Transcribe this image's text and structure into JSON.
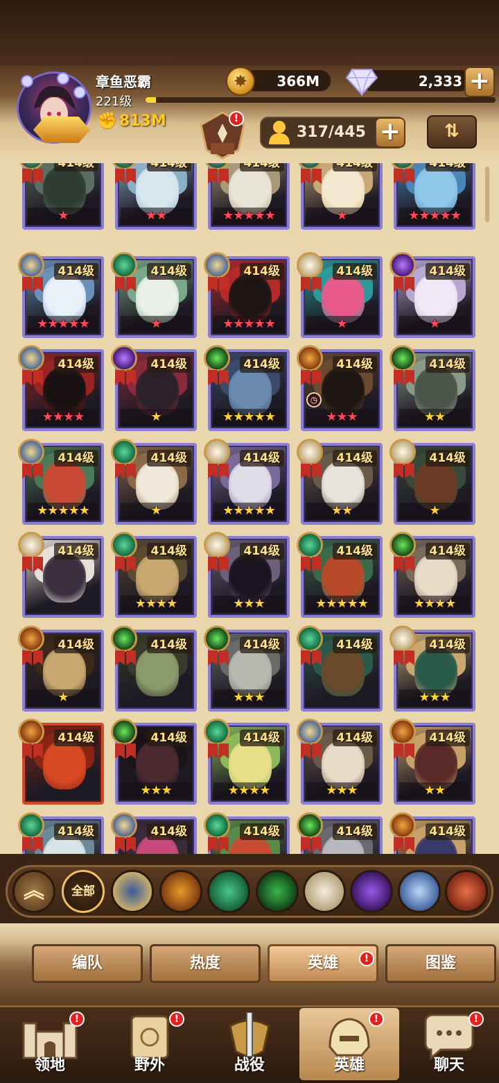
{
  "player": {
    "name": "章鱼恶霸",
    "level": "221级",
    "xp_progress": 0.03,
    "power": "813M"
  },
  "currencies": {
    "gold": "366M",
    "diamonds": "2,333"
  },
  "roster": {
    "count": "317/445"
  },
  "hero_level_label": "414级",
  "heroes": [
    {
      "level": "414级",
      "faction": "forest",
      "stars": "★",
      "star_color": "red",
      "palette": [
        "#2f3c34",
        "#5a6e64"
      ]
    },
    {
      "level": "414级",
      "faction": "forest",
      "stars": "★★",
      "star_color": "red",
      "palette": [
        "#d8e6ee",
        "#8ab0c8"
      ]
    },
    {
      "level": "414级",
      "faction": "forest",
      "stars": "★★★★★",
      "star_color": "red",
      "palette": [
        "#e8e4d8",
        "#a89a78"
      ]
    },
    {
      "level": "414级",
      "faction": "forest",
      "stars": "★",
      "star_color": "red",
      "palette": [
        "#f4e8d0",
        "#c8a878"
      ]
    },
    {
      "level": "414级",
      "faction": "forest",
      "stars": "★★★★★",
      "star_color": "red",
      "palette": [
        "#8fc8e8",
        "#4a86b8"
      ]
    },
    {
      "level": "414级",
      "faction": "lightbearer",
      "stars": "★★★★★",
      "star_color": "red",
      "palette": [
        "#e8f0f8",
        "#6a90b8"
      ]
    },
    {
      "level": "414级",
      "faction": "wilder",
      "stars": "★",
      "star_color": "red",
      "palette": [
        "#e8f0e8",
        "#7aa88a"
      ]
    },
    {
      "level": "414级",
      "faction": "lightbearer",
      "stars": "★★★★★",
      "star_color": "red",
      "palette": [
        "#1e1414",
        "#b42a2a"
      ]
    },
    {
      "level": "414级",
      "faction": "celestial",
      "stars": "★",
      "star_color": "red",
      "palette": [
        "#e85a8a",
        "#2a9a9a"
      ]
    },
    {
      "level": "414级",
      "faction": "hypogean",
      "stars": "★",
      "star_color": "red",
      "palette": [
        "#f0e8f4",
        "#b8a8d0"
      ]
    },
    {
      "level": "414级",
      "faction": "lightbearer",
      "stars": "★★★★",
      "star_color": "red",
      "palette": [
        "#1a1212",
        "#9a2424"
      ]
    },
    {
      "level": "414级",
      "faction": "hypogean",
      "stars": "★",
      "star_color": "gold",
      "palette": [
        "#2a2228",
        "#8a2a3a"
      ]
    },
    {
      "level": "414级",
      "faction": "graveborn",
      "stars": "★★★★★",
      "star_color": "gold",
      "palette": [
        "#6a8ab0",
        "#3a4a68"
      ]
    },
    {
      "level": "414级",
      "faction": "mauler",
      "stars": "★★★",
      "star_color": "red",
      "palette": [
        "#1e1612",
        "#6a4a30"
      ],
      "clock": true
    },
    {
      "level": "414级",
      "faction": "graveborn",
      "stars": "★★",
      "star_color": "gold",
      "palette": [
        "#4a5448",
        "#8a9a88"
      ]
    },
    {
      "level": "414级",
      "faction": "lightbearer",
      "stars": "★★★★★",
      "star_color": "gold",
      "palette": [
        "#c84a34",
        "#4a7a5a"
      ]
    },
    {
      "level": "414级",
      "faction": "wilder",
      "stars": "★",
      "star_color": "gold",
      "palette": [
        "#f0e8d8",
        "#8a6a48"
      ]
    },
    {
      "level": "414级",
      "faction": "celestial",
      "stars": "★★★★★",
      "star_color": "gold",
      "palette": [
        "#e0dce8",
        "#7a6a9a"
      ]
    },
    {
      "level": "414级",
      "faction": "celestial",
      "stars": "★★",
      "star_color": "gold",
      "palette": [
        "#e8e4dc",
        "#6a5a48"
      ]
    },
    {
      "level": "414级",
      "faction": "celestial",
      "stars": "★",
      "star_color": "gold",
      "palette": [
        "#6a3a24",
        "#3a4a3a"
      ]
    },
    {
      "level": "414级",
      "faction": "celestial",
      "stars": "",
      "star_color": "gold",
      "palette": [
        "#3a3040",
        "#e8e0d8"
      ]
    },
    {
      "level": "414级",
      "faction": "wilder",
      "stars": "★★★★",
      "star_color": "gold",
      "palette": [
        "#c8a870",
        "#5a4a30"
      ]
    },
    {
      "level": "414级",
      "faction": "celestial",
      "stars": "★★★",
      "star_color": "gold",
      "palette": [
        "#1a1420",
        "#6a6078"
      ]
    },
    {
      "level": "414级",
      "faction": "wilder",
      "stars": "★★★★★",
      "star_color": "gold",
      "palette": [
        "#b84a2a",
        "#3a6a4a"
      ]
    },
    {
      "level": "414级",
      "faction": "graveborn",
      "stars": "★★★★",
      "star_color": "gold",
      "palette": [
        "#e8dcc8",
        "#7a6a5a"
      ]
    },
    {
      "level": "414级",
      "faction": "mauler",
      "stars": "★",
      "star_color": "gold",
      "palette": [
        "#c8a870",
        "#3a2818"
      ]
    },
    {
      "level": "414级",
      "faction": "graveborn",
      "stars": "",
      "star_color": "gold",
      "palette": [
        "#8a9a6a",
        "#3a3a2a"
      ]
    },
    {
      "level": "414级",
      "faction": "graveborn",
      "stars": "★★★",
      "star_color": "gold",
      "palette": [
        "#b8b8b0",
        "#6a6a68"
      ]
    },
    {
      "level": "414级",
      "faction": "wilder",
      "stars": "",
      "star_color": "gold",
      "palette": [
        "#6a4a2a",
        "#2a5a4a"
      ]
    },
    {
      "level": "414级",
      "faction": "celestial",
      "stars": "★★★",
      "star_color": "gold",
      "palette": [
        "#2a5a4a",
        "#c8a870"
      ]
    },
    {
      "level": "414级",
      "faction": "mauler",
      "stars": "",
      "star_color": "gold",
      "palette": [
        "#d84a24",
        "#8a2414"
      ],
      "red_frame": true
    },
    {
      "level": "414级",
      "faction": "graveborn",
      "stars": "★★★",
      "star_color": "gold",
      "palette": [
        "#4a2a30",
        "#1a1418"
      ]
    },
    {
      "level": "414级",
      "faction": "wilder",
      "stars": "★★★★",
      "star_color": "gold",
      "palette": [
        "#e8e088",
        "#8ab85a"
      ]
    },
    {
      "level": "414级",
      "faction": "lightbearer",
      "stars": "★★★",
      "star_color": "gold",
      "palette": [
        "#e8dcc8",
        "#6a5a48"
      ]
    },
    {
      "level": "414级",
      "faction": "mauler",
      "stars": "★★",
      "star_color": "gold",
      "palette": [
        "#5a2a28",
        "#c8a06a"
      ]
    },
    {
      "level": "414级",
      "faction": "wilder",
      "stars": "",
      "star_color": "gold",
      "palette": [
        "#d8e4e8",
        "#6a8a98"
      ]
    },
    {
      "level": "414级",
      "faction": "lightbearer",
      "stars": "",
      "star_color": "gold",
      "palette": [
        "#c84a7a",
        "#3a2a3a"
      ]
    },
    {
      "level": "414级",
      "faction": "wilder",
      "stars": "",
      "star_color": "gold",
      "palette": [
        "#c84a34",
        "#5a8a4a"
      ]
    },
    {
      "level": "414级",
      "faction": "graveborn",
      "stars": "",
      "star_color": "gold",
      "palette": [
        "#b8b8c0",
        "#6a6870"
      ]
    },
    {
      "level": "414级",
      "faction": "mauler",
      "stars": "",
      "star_color": "gold",
      "palette": [
        "#3a3a6a",
        "#c8a06a"
      ]
    }
  ],
  "faction_filters": [
    {
      "id": "collapse",
      "label": "",
      "icon": "chevron-up-icon",
      "colors": [
        "#a07a48",
        "#5a3a1c"
      ]
    },
    {
      "id": "all",
      "label": "全部",
      "icon": "",
      "colors": [
        "#4a3018",
        "#2a1a0c"
      ]
    },
    {
      "id": "lightbearer",
      "label": "",
      "icon": "lightbearer-icon",
      "colors": [
        "#3a5a9a",
        "#e8c060"
      ]
    },
    {
      "id": "mauler",
      "label": "",
      "icon": "mauler-icon",
      "colors": [
        "#e89a2a",
        "#6a2a0a"
      ]
    },
    {
      "id": "wilder",
      "label": "",
      "icon": "wilder-icon",
      "colors": [
        "#4ac88a",
        "#0a4a2a"
      ]
    },
    {
      "id": "graveborn",
      "label": "",
      "icon": "graveborn-icon",
      "colors": [
        "#3ab84a",
        "#0a2a10"
      ]
    },
    {
      "id": "celestial",
      "label": "",
      "icon": "celestial-icon",
      "colors": [
        "#f4ecdc",
        "#a8946a"
      ]
    },
    {
      "id": "hypogean",
      "label": "",
      "icon": "hypogean-icon",
      "colors": [
        "#9a5ae8",
        "#2a0a4a"
      ]
    },
    {
      "id": "dimensional",
      "label": "",
      "icon": "dimensional-icon",
      "colors": [
        "#b8d8f8",
        "#2a4a8a"
      ]
    },
    {
      "id": "dragon",
      "label": "",
      "icon": "dragon-icon",
      "colors": [
        "#e8704a",
        "#6a1a0a"
      ]
    }
  ],
  "sub_tabs": [
    {
      "id": "formation",
      "label": "编队"
    },
    {
      "id": "popularity",
      "label": "热度"
    },
    {
      "id": "heroes",
      "label": "英雄",
      "active": true,
      "alert": true
    },
    {
      "id": "collection",
      "label": "图鉴"
    }
  ],
  "bottom_nav": [
    {
      "id": "territory",
      "label": "领地",
      "icon": "castle-icon",
      "alert": true
    },
    {
      "id": "wild",
      "label": "野外",
      "icon": "scroll-map-icon",
      "alert": true
    },
    {
      "id": "campaign",
      "label": "战役",
      "icon": "sword-shield-icon",
      "alert": false
    },
    {
      "id": "heroes",
      "label": "英雄",
      "icon": "helmet-icon",
      "alert": true,
      "active": true
    },
    {
      "id": "chat",
      "label": "聊天",
      "icon": "chat-bubble-icon",
      "alert": true
    }
  ],
  "faction_colors": {
    "lightbearer": [
      "#f0d890",
      "#3a5a9a"
    ],
    "mauler": [
      "#f0a840",
      "#7a2a0a"
    ],
    "wilder": [
      "#5ad89a",
      "#0a5a34"
    ],
    "graveborn": [
      "#6ae85a",
      "#0a3010"
    ],
    "celestial": [
      "#fff8e8",
      "#b8a070"
    ],
    "hypogean": [
      "#b87aff",
      "#3a0a6a"
    ],
    "forest": [
      "#5ac8a0",
      "#1a4a3a"
    ]
  }
}
